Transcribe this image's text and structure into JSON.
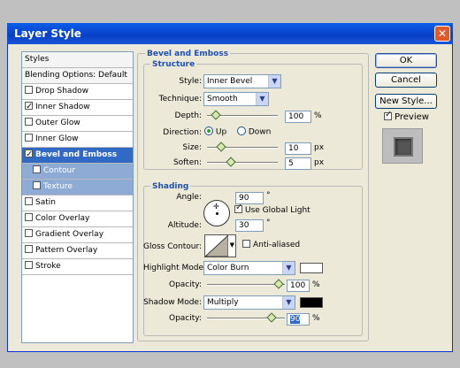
{
  "window": {
    "title": "Layer Style",
    "close_label": "✕"
  },
  "sidebar": {
    "items": [
      {
        "label": "Styles",
        "type": "header"
      },
      {
        "label": "Blending Options: Default",
        "type": "header"
      },
      {
        "label": "Drop Shadow",
        "checked": false
      },
      {
        "label": "Inner Shadow",
        "checked": true
      },
      {
        "label": "Outer Glow",
        "checked": false
      },
      {
        "label": "Inner Glow",
        "checked": false
      },
      {
        "label": "Bevel and Emboss",
        "checked": true,
        "selected": true
      },
      {
        "label": "Contour",
        "checked": false,
        "sub": true
      },
      {
        "label": "Texture",
        "checked": false,
        "sub": true
      },
      {
        "label": "Satin",
        "checked": false
      },
      {
        "label": "Color Overlay",
        "checked": false
      },
      {
        "label": "Gradient Overlay",
        "checked": false
      },
      {
        "label": "Pattern Overlay",
        "checked": false
      },
      {
        "label": "Stroke",
        "checked": false
      }
    ]
  },
  "bevel": {
    "panel_title": "Bevel and Emboss",
    "structure_title": "Structure",
    "style_label": "Style:",
    "style_value": "Inner Bevel",
    "technique_label": "Technique:",
    "technique_value": "Smooth",
    "depth_label": "Depth:",
    "depth_value": "100",
    "depth_unit": "%",
    "direction_label": "Direction:",
    "direction_up": "Up",
    "direction_down": "Down",
    "size_label": "Size:",
    "size_value": "10",
    "size_unit": "px",
    "soften_label": "Soften:",
    "soften_value": "5",
    "soften_unit": "px"
  },
  "shading": {
    "title": "Shading",
    "angle_label": "Angle:",
    "angle_value": "90",
    "angle_unit": "°",
    "use_global_light": "Use Global Light",
    "altitude_label": "Altitude:",
    "altitude_value": "30",
    "altitude_unit": "°",
    "gloss_contour_label": "Gloss Contour:",
    "anti_aliased": "Anti-aliased",
    "highlight_mode_label": "Highlight Mode:",
    "highlight_mode_value": "Color Burn",
    "highlight_color": "#ffffff",
    "highlight_opacity_label": "Opacity:",
    "highlight_opacity_value": "100",
    "shadow_mode_label": "Shadow Mode:",
    "shadow_mode_value": "Multiply",
    "shadow_color": "#000000",
    "shadow_opacity_label": "Opacity:",
    "shadow_opacity_value": "90",
    "percent": "%"
  },
  "buttons": {
    "ok": "OK",
    "cancel": "Cancel",
    "new_style": "New Style...",
    "preview": "Preview"
  },
  "colors": {
    "accent": "#316ac5",
    "title_bar": "#0a46d0",
    "heading": "#1f4fb4"
  }
}
